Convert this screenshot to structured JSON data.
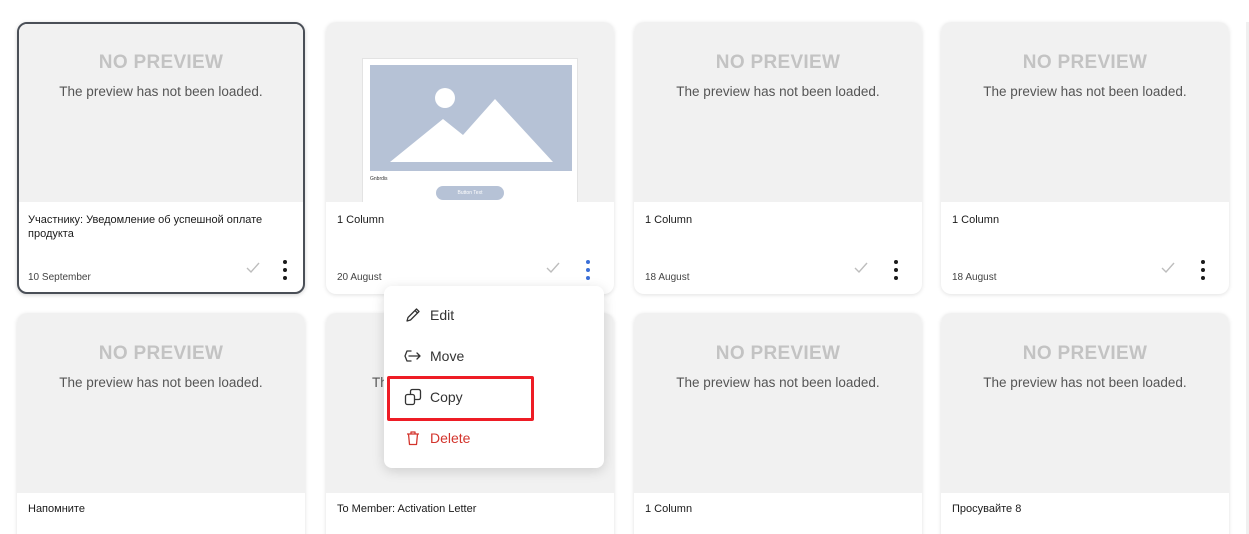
{
  "colors": {
    "accent": "#3b6fd8",
    "danger": "#d3342c",
    "highlight": "#ee1c25",
    "preview_bg": "#f1f1f1"
  },
  "no_preview": {
    "title": "NO PREVIEW",
    "subtitle": "The preview has not been loaded."
  },
  "cards": [
    {
      "title": "Участнику: Уведомление об успешной оплате продукта",
      "date": "10 September",
      "preview": "none",
      "selected": true
    },
    {
      "title": "1 Column",
      "date": "20 August",
      "preview": "thumbnail",
      "thumb_brand": "Gnbrdis",
      "thumb_button": "Button Text",
      "menu_open": true
    },
    {
      "title": "1 Column",
      "date": "18 August",
      "preview": "none"
    },
    {
      "title": "1 Column",
      "date": "18 August",
      "preview": "none"
    },
    {
      "title": "Напомните",
      "preview": "none"
    },
    {
      "title": "To Member: Activation Letter",
      "preview": "partial",
      "subtitle_fragment": "Th"
    },
    {
      "title": "1 Column",
      "preview": "none"
    },
    {
      "title": "Просувайте 8",
      "preview": "none"
    }
  ],
  "context_menu": {
    "items": [
      {
        "label": "Edit",
        "icon": "pencil-icon"
      },
      {
        "label": "Move",
        "icon": "move-icon"
      },
      {
        "label": "Copy",
        "icon": "copy-icon"
      },
      {
        "label": "Delete",
        "icon": "trash-icon"
      }
    ]
  }
}
